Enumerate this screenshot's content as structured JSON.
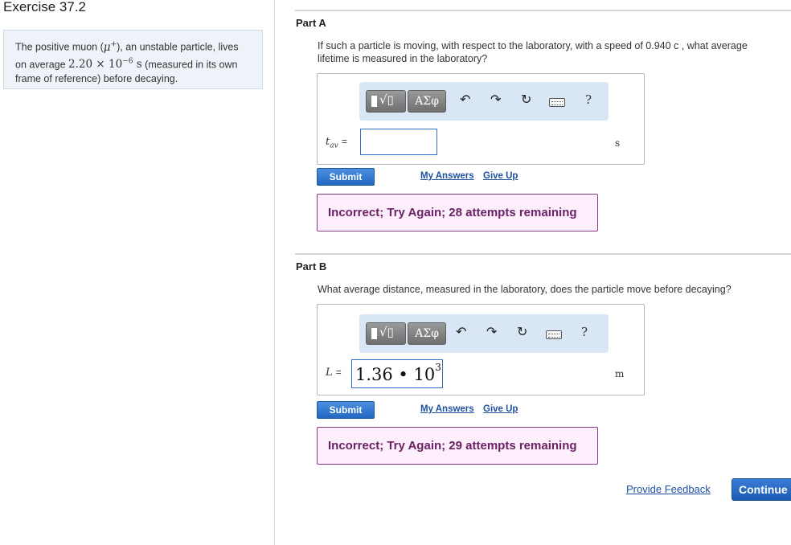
{
  "exercise": {
    "title": "Exercise 37.2"
  },
  "prompt": {
    "text_1": "The positive muon (",
    "particle": "μ",
    "particle_sup": "+",
    "text_2": "), an unstable particle, lives",
    "text_3": "on average ",
    "lifetime_coef": "2.20 × 10",
    "lifetime_exp": "−6",
    "lifetime_unit": "s",
    "text_4": " (measured in its own",
    "text_5": "frame of reference) before decaying."
  },
  "toolbar": {
    "greek_label": "ΑΣφ",
    "radical_label": "√▯",
    "undo_icon": "↶",
    "redo_icon": "↷",
    "reset_icon": "↻",
    "help_label": "?"
  },
  "part_a": {
    "label": "Part A",
    "question_line1": "If such a particle is moving, with respect to the laboratory, with a speed of 0.940 c , what average",
    "question_line2": "lifetime is measured in the laboratory?",
    "var_name": "t",
    "var_sub": "av",
    "equals": "=",
    "input_value": "",
    "unit": "s",
    "submit_label": "Submit",
    "my_answers_label": "My Answers",
    "give_up_label": "Give Up",
    "feedback": "Incorrect; Try Again; 28 attempts remaining"
  },
  "part_b": {
    "label": "Part B",
    "question": "What average distance, measured in the laboratory, does the particle move before decaying?",
    "var_name": "L",
    "equals": "=",
    "input_value_main": "1.36 • 10",
    "input_value_exp": "3",
    "unit": "m",
    "submit_label": "Submit",
    "my_answers_label": "My Answers",
    "give_up_label": "Give Up",
    "feedback": "Incorrect; Try Again; 29 attempts remaining"
  },
  "footer": {
    "provide_feedback_label": "Provide Feedback",
    "continue_label": "Continue"
  }
}
